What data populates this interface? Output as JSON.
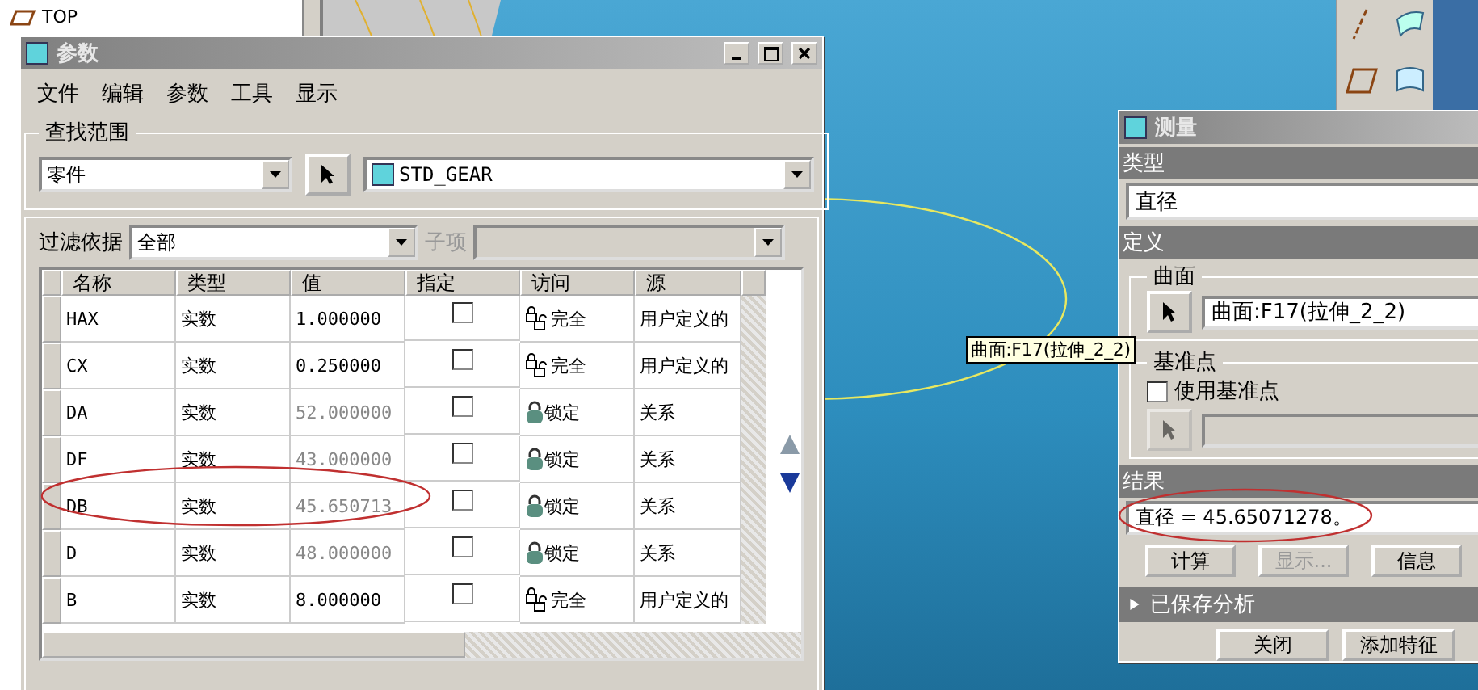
{
  "model_tree": {
    "items": [
      {
        "label": "TOP"
      }
    ]
  },
  "params_dialog": {
    "title": "参数",
    "menu": [
      "文件",
      "编辑",
      "参数",
      "工具",
      "显示"
    ],
    "scope": {
      "label": "查找范围",
      "level": "零件",
      "model": "STD_GEAR"
    },
    "filter": {
      "label": "过滤依据",
      "value": "全部",
      "sub_label": "子项",
      "sub_disabled": true
    },
    "table": {
      "columns": [
        "名称",
        "类型",
        "值",
        "指定",
        "访问",
        "源"
      ],
      "rows": [
        {
          "name": "HAX",
          "type": "实数",
          "value": "1.000000",
          "designated": false,
          "locked": false,
          "access": "完全",
          "source": "用户定义的"
        },
        {
          "name": "CX",
          "type": "实数",
          "value": "0.250000",
          "designated": false,
          "locked": false,
          "access": "完全",
          "source": "用户定义的"
        },
        {
          "name": "DA",
          "type": "实数",
          "value": "52.000000",
          "designated": false,
          "locked": true,
          "access": "锁定",
          "source": "关系"
        },
        {
          "name": "DF",
          "type": "实数",
          "value": "43.000000",
          "designated": false,
          "locked": true,
          "access": "锁定",
          "source": "关系"
        },
        {
          "name": "DB",
          "type": "实数",
          "value": "45.650713",
          "designated": false,
          "locked": true,
          "access": "锁定",
          "source": "关系"
        },
        {
          "name": "D",
          "type": "实数",
          "value": "48.000000",
          "designated": false,
          "locked": true,
          "access": "锁定",
          "source": "关系"
        },
        {
          "name": "B",
          "type": "实数",
          "value": "8.000000",
          "designated": false,
          "locked": false,
          "access": "完全",
          "source": "用户定义的"
        }
      ]
    }
  },
  "tooltip": "曲面:F17(拉伸_2_2)",
  "measure_dialog": {
    "title": "测量",
    "type_label": "类型",
    "type_value": "直径",
    "definition_label": "定义",
    "surface": {
      "label": "曲面",
      "value": "曲面:F17(拉伸_2_2)"
    },
    "datum": {
      "label": "基准点",
      "checkbox": "使用基准点",
      "checked": false
    },
    "result_label": "结果",
    "result": "直径 = 45.65071278。",
    "buttons": [
      {
        "label": "计算",
        "disabled": false
      },
      {
        "label": "显示...",
        "disabled": true
      },
      {
        "label": "信息",
        "disabled": false
      }
    ],
    "saved": {
      "label": "已保存分析",
      "expanded": false
    },
    "footer_buttons": [
      {
        "label": "关闭",
        "disabled": false
      },
      {
        "label": "添加特征",
        "disabled": false
      }
    ]
  }
}
